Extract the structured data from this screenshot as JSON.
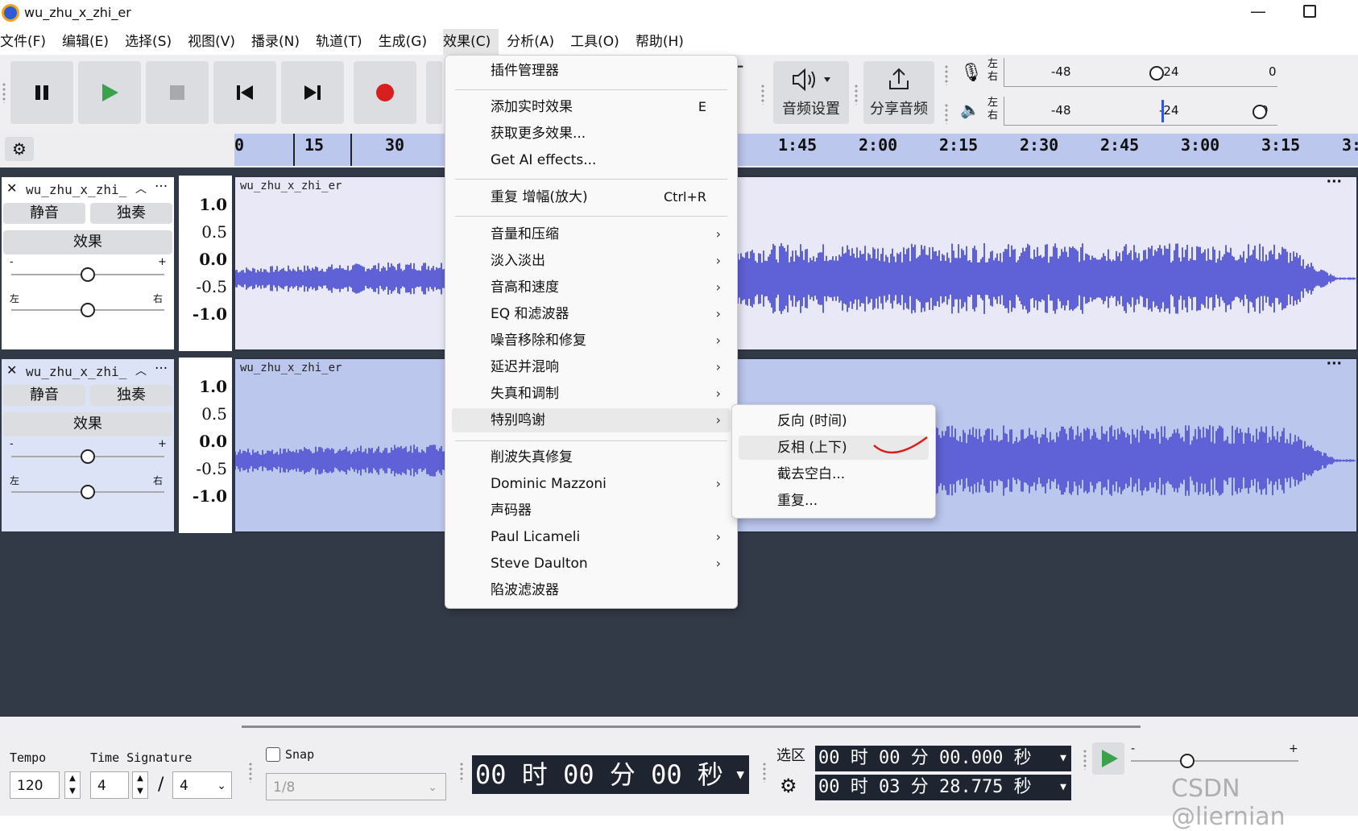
{
  "window": {
    "title": "wu_zhu_x_zhi_er",
    "minimize": "—"
  },
  "menubar": [
    "文件(F)",
    "编辑(E)",
    "选择(S)",
    "视图(V)",
    "播录(N)",
    "轨道(T)",
    "生成(G)",
    "效果(C)",
    "分析(A)",
    "工具(O)",
    "帮助(H)"
  ],
  "toolbar": {
    "audio_setup": "音频设置",
    "share_audio": "分享音频",
    "meter_lr": [
      "左",
      "右"
    ],
    "meter_ticks": [
      "-48",
      "-24",
      "0"
    ]
  },
  "ruler": {
    "ticks": [
      "0",
      "15",
      "30",
      "1:45",
      "2:00",
      "2:15",
      "2:30",
      "2:45",
      "3:00",
      "3:15",
      "3:"
    ]
  },
  "tracks": [
    {
      "name": "wu_zhu_x_zhi_",
      "clip": "wu_zhu_x_zhi_er",
      "mute": "静音",
      "solo": "独奏",
      "effects": "效果",
      "gain_minus": "-",
      "gain_plus": "+",
      "pan_l": "左",
      "pan_r": "右",
      "scale": [
        "1.0",
        "0.5",
        "0.0",
        "-0.5",
        "-1.0"
      ],
      "more": "···"
    },
    {
      "name": "wu_zhu_x_zhi_",
      "clip": "wu_zhu_x_zhi_er",
      "mute": "静音",
      "solo": "独奏",
      "effects": "效果",
      "gain_minus": "-",
      "gain_plus": "+",
      "pan_l": "左",
      "pan_r": "右",
      "scale": [
        "1.0",
        "0.5",
        "0.0",
        "-0.5",
        "-1.0"
      ],
      "more": "···"
    }
  ],
  "effects_menu": [
    {
      "label": "插件管理器"
    },
    {
      "label": "添加实时效果",
      "acc": "E"
    },
    {
      "label": "获取更多效果..."
    },
    {
      "label": "Get AI effects..."
    },
    {
      "label": "重复 增幅(放大)",
      "acc": "Ctrl+R"
    },
    {
      "label": "音量和压缩"
    },
    {
      "label": "淡入淡出"
    },
    {
      "label": "音高和速度"
    },
    {
      "label": "EQ 和滤波器"
    },
    {
      "label": "噪音移除和修复"
    },
    {
      "label": "延迟并混响"
    },
    {
      "label": "失真和调制"
    },
    {
      "label": "特别鸣谢"
    },
    {
      "label": "削波失真修复"
    },
    {
      "label": "Dominic Mazzoni"
    },
    {
      "label": "声码器"
    },
    {
      "label": "Paul Licameli"
    },
    {
      "label": "Steve Daulton"
    },
    {
      "label": "陷波滤波器"
    }
  ],
  "submenu": [
    "反向 (时间)",
    "反相 (上下)",
    "截去空白...",
    "重复..."
  ],
  "bottom": {
    "tempo_label": "Tempo",
    "tempo_value": "120",
    "timesig_label": "Time Signature",
    "timesig_num": "4",
    "timesig_sep": "/",
    "timesig_den": "4",
    "snap_label": "Snap",
    "snap_value": "1/8",
    "time_display": "00 时 00 分 00 秒",
    "selection_label": "选区",
    "sel_start": "00 时 00 分 00.000 秒",
    "sel_end": "00 时 03 分 28.775 秒",
    "slider_minus": "-",
    "slider_plus": "+"
  },
  "watermark": "CSDN @liernian",
  "colors": {
    "waveform": "#5f61d6",
    "selection": "#bcc7ee",
    "accent_red": "#d81e1e",
    "play_green": "#3aa24a"
  }
}
